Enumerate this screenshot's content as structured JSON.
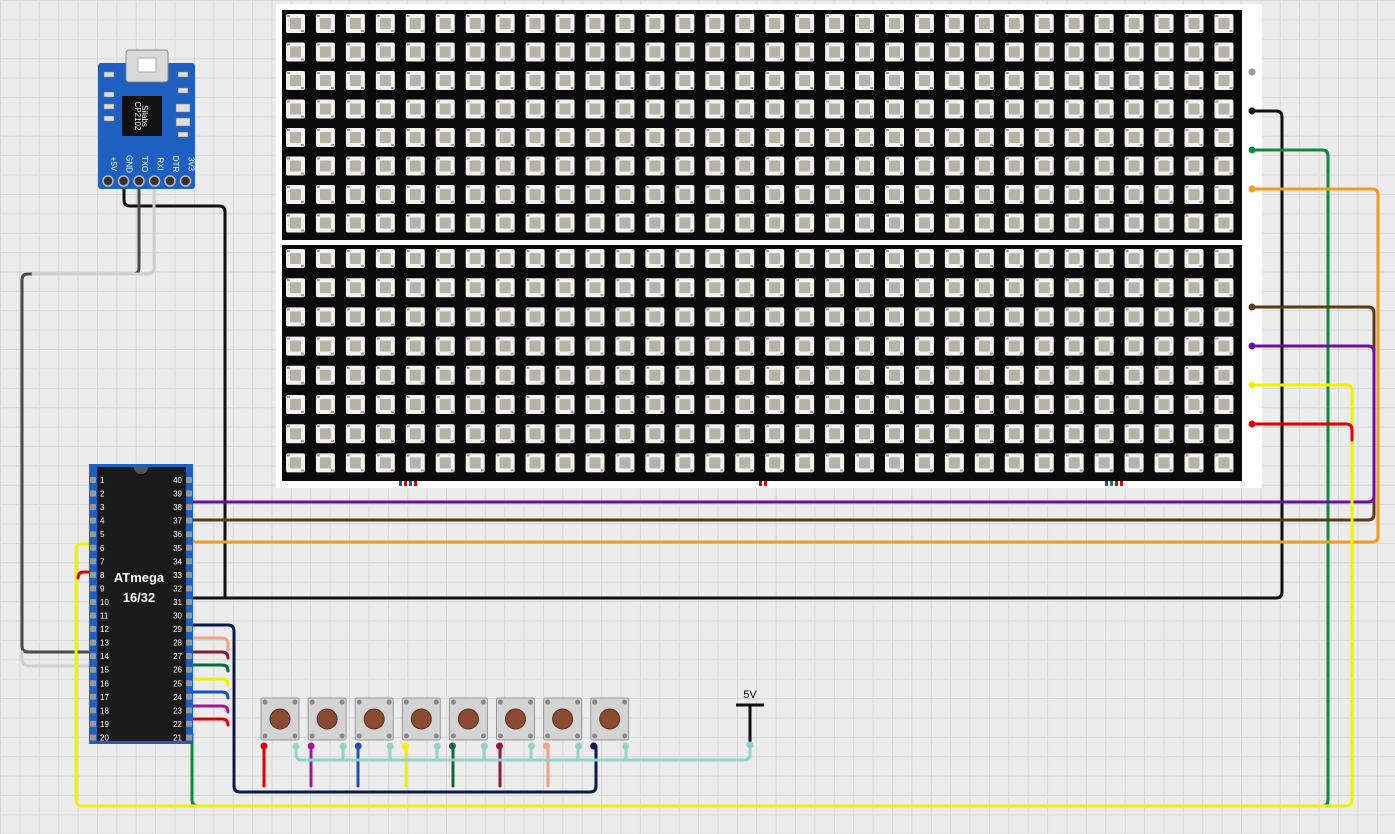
{
  "usb_module": {
    "chip_brand": "Silabs",
    "chip_model": "CP2102",
    "pins": [
      "+5V",
      "GND",
      "TXO",
      "RXI",
      "DTR",
      "3V3"
    ]
  },
  "mcu": {
    "name_line1": "ATmega",
    "name_line2": "16/32",
    "left_pins": [
      "1",
      "2",
      "3",
      "4",
      "5",
      "6",
      "7",
      "8",
      "9",
      "10",
      "11",
      "12",
      "13",
      "14",
      "15",
      "16",
      "17",
      "18",
      "19",
      "20"
    ],
    "right_pins": [
      "40",
      "39",
      "38",
      "37",
      "36",
      "35",
      "34",
      "33",
      "32",
      "31",
      "30",
      "29",
      "28",
      "27",
      "26",
      "25",
      "24",
      "23",
      "22",
      "21"
    ]
  },
  "power": {
    "label": "5V"
  },
  "button_count": 8,
  "led_matrix": {
    "columns": 32,
    "rows_per_panel": 8,
    "panels": 2
  },
  "colors": {
    "black": "#111111",
    "green": "#0f8a3c",
    "orange": "#f39c1e",
    "brown": "#5a3a12",
    "purple": "#6a0dad",
    "yellow": "#f2f200",
    "red": "#e00000",
    "navy": "#0b1a4d",
    "salmon": "#f4a08a",
    "maroon": "#8b1a3a",
    "blue": "#1f4fbf",
    "darkgreen": "#0a6b3a",
    "teal": "#8fd3cc",
    "magenta": "#a0199a",
    "gray": "#4a4a4a",
    "lightgray": "#cfcfcf"
  }
}
